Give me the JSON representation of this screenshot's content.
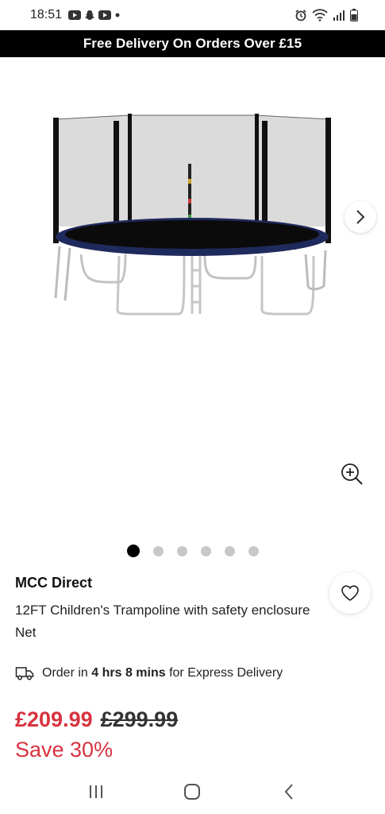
{
  "status_bar": {
    "time": "18:51",
    "left_icons": [
      "youtube-icon",
      "snapchat-icon",
      "youtube-icon",
      "notification-dot-icon"
    ],
    "right_icons": [
      "alarm-icon",
      "wifi-icon",
      "signal-icon",
      "battery-icon"
    ]
  },
  "banner": {
    "text": "Free Delivery On Orders Over £15"
  },
  "gallery": {
    "image_subject": "trampoline-with-safety-net",
    "dot_count": 6,
    "active_index": 0
  },
  "product": {
    "brand": "MCC Direct",
    "title": "12FT Children's Trampoline with safety enclosure Net"
  },
  "delivery": {
    "prefix": "Order in",
    "time": "4 hrs 8 mins",
    "suffix": "for Express Delivery"
  },
  "price": {
    "current": "£209.99",
    "was": "£299.99",
    "save": "Save 30%"
  },
  "colors": {
    "sale_red": "#d8333f",
    "banner_bg": "#000000",
    "trampoline_blue": "#1f2a5c"
  }
}
